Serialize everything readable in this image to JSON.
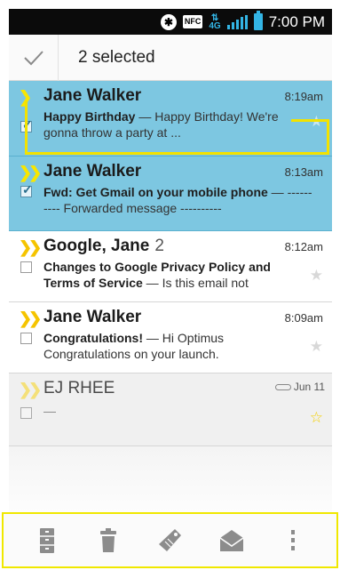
{
  "status_bar": {
    "bluetooth_icon": "bluetooth-icon",
    "nfc_label": "NFC",
    "network_label": "4G",
    "time": "7:00 PM"
  },
  "action_bar": {
    "done_icon": "check-icon",
    "selected_text": "2 selected"
  },
  "emails": [
    {
      "sender": "Jane Walker",
      "count": "",
      "time": "8:19am",
      "subject": "Happy Birthday",
      "preview": " — Happy Birthday! We're gonna throw a party at ...",
      "selected": true,
      "starred": false
    },
    {
      "sender": "Jane Walker",
      "count": "",
      "time": "8:13am",
      "subject": "Fwd: Get Gmail on your mobile phone",
      "preview": " — ---------- Forwarded message ----------",
      "selected": true,
      "starred": false
    },
    {
      "sender": "Google, Jane",
      "count": "2",
      "time": "8:12am",
      "subject": "Changes to Google Privacy Policy and Terms of Service",
      "preview": " — Is this email not",
      "selected": false,
      "starred": false
    },
    {
      "sender": "Jane Walker",
      "count": "",
      "time": "8:09am",
      "subject": "Congratulations!",
      "preview": " — Hi Optimus Congratulations on your launch.",
      "selected": false,
      "starred": false
    },
    {
      "sender": "EJ RHEE",
      "count": "",
      "time": "Jun 11",
      "subject": "",
      "preview": "—",
      "selected": false,
      "starred": true,
      "has_attachment": true,
      "read": true
    }
  ],
  "bottom_bar": {
    "actions": [
      "archive-icon",
      "delete-icon",
      "label-icon",
      "mark-unread-icon",
      "overflow-menu-icon"
    ]
  },
  "colors": {
    "selected_row": "#7dc7e1",
    "highlight": "#f2e200",
    "accent": "#33b5e5",
    "importance_marker": "#f5c400",
    "star_on": "#f5d000"
  }
}
